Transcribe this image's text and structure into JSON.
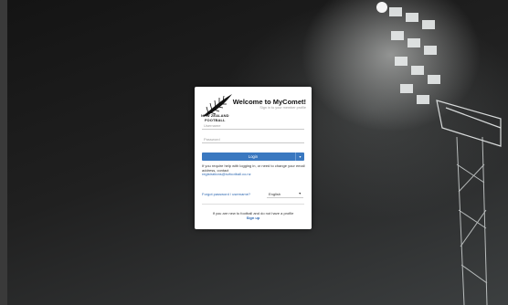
{
  "page": {
    "title": "Welcome to MyComet!",
    "subtitle": "Sign in to your member profile"
  },
  "brand": {
    "line1": "NEW ZEALAND",
    "line2": "FOOTBALL",
    "logo_icon": "fern-icon"
  },
  "form": {
    "username_placeholder": "Username",
    "password_placeholder": "Password",
    "login_label": "Login",
    "login_dropdown_icon": "caret-down-icon"
  },
  "help": {
    "text": "If you require help with logging in, or need to change your email address, contact",
    "email": "registrations@nzfootball.co.nz"
  },
  "links": {
    "forgot": "Forgot password / username?"
  },
  "language": {
    "selected": "English",
    "chevron_icon": "chevron-down-icon"
  },
  "footer": {
    "text": "If you are new to football and do not have a profile",
    "signup": "Sign up"
  },
  "colors": {
    "accent": "#3a78c0",
    "link": "#2c67b0"
  }
}
